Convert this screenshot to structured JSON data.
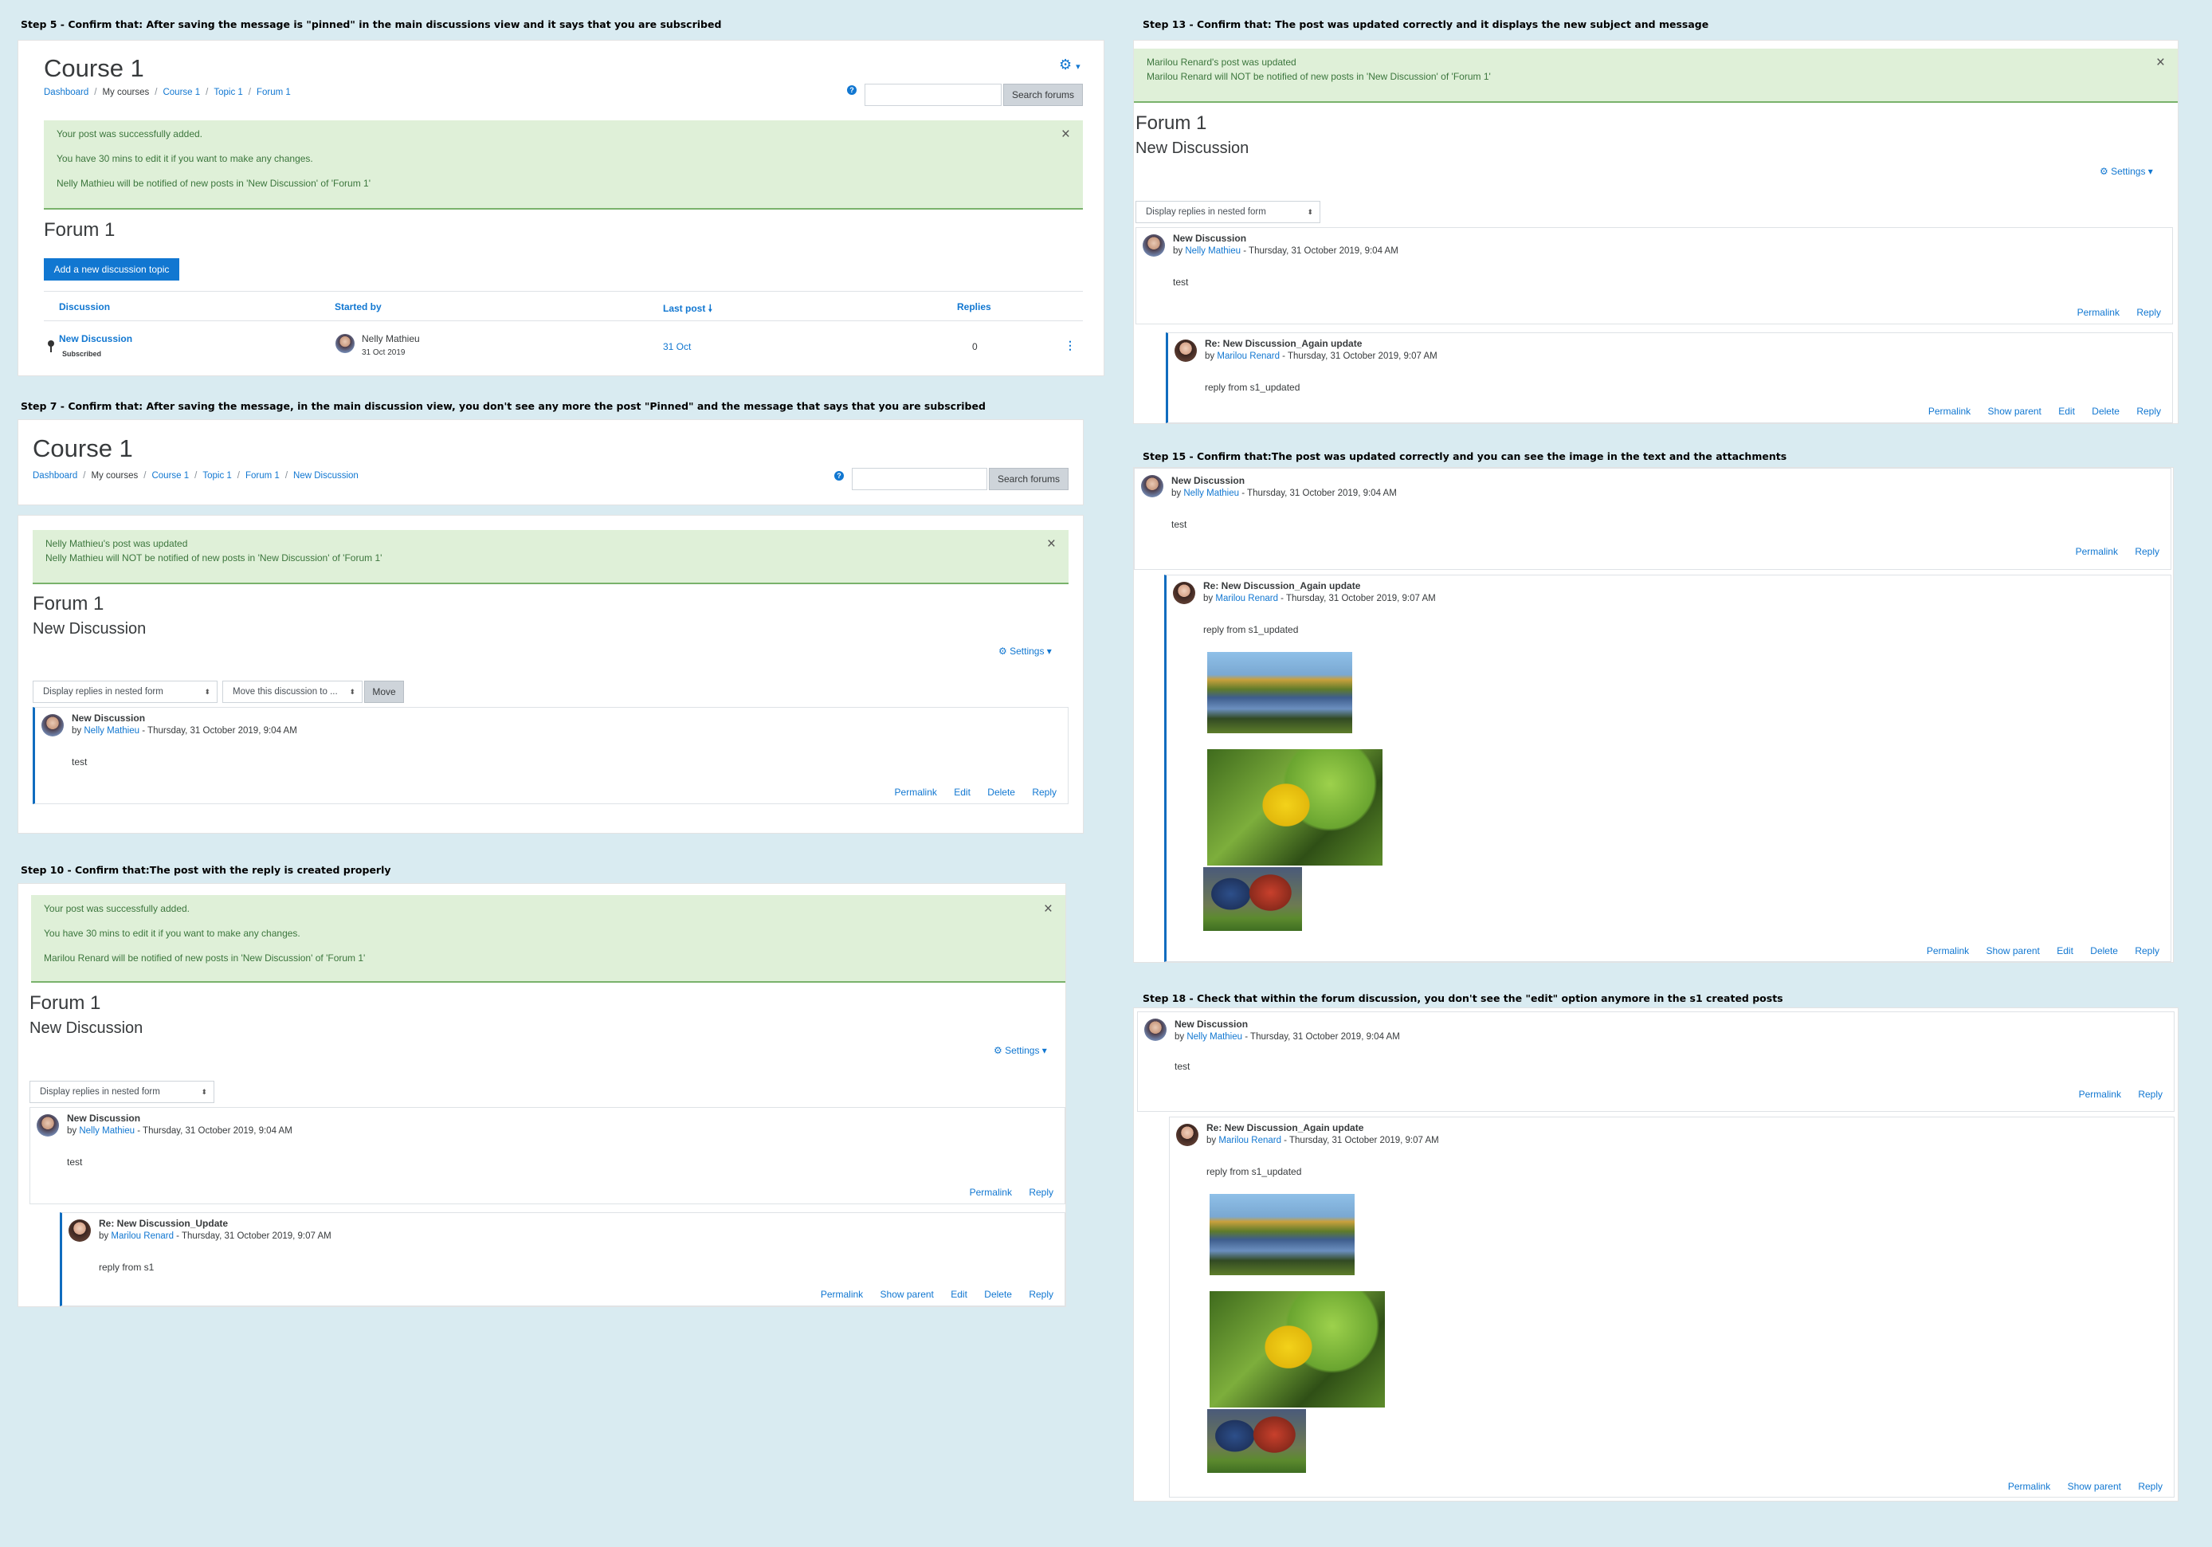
{
  "steps": {
    "s5": "Step 5 - Confirm that: After saving the message is \"pinned\" in the main discussions view and it says that you are subscribed",
    "s7": "Step 7 - Confirm that: After saving the message, in the main discussion view, you don't see any more the post \"Pinned\" and the message that says that you are subscribed",
    "s10": "Step 10 - Confirm that:The post with the reply is created properly",
    "s13": "Step 13 - Confirm that: The post was updated correctly and it displays the new subject and message",
    "s15": "Step 15 - Confirm that:The post was updated correctly and you can see the image in the text and the attachments",
    "s18": "Step 18 - Check that within the forum discussion, you don't see the \"edit\" option anymore in the s1 created posts"
  },
  "common": {
    "course_title": "Course 1",
    "crumb_dashboard": "Dashboard",
    "crumb_mycourses": "My courses",
    "crumb_course": "Course 1",
    "crumb_topic": "Topic 1",
    "crumb_forum": "Forum 1",
    "crumb_discussion": "New Discussion",
    "search_btn": "Search forums",
    "forum_title": "Forum 1",
    "discussion_title": "New Discussion",
    "settings": "Settings",
    "display_mode": "Display replies in nested form",
    "move_select": "Move this discussion to ...",
    "move_btn": "Move",
    "close": "×",
    "help": "?"
  },
  "s5": {
    "alert1": "Your post was successfully added.",
    "alert2": "You have 30 mins to edit it if you want to make any changes.",
    "alert3": "Nelly Mathieu will be notified of new posts in 'New Discussion' of 'Forum 1'",
    "add_btn": "Add a new discussion topic",
    "col_discussion": "Discussion",
    "col_started": "Started by",
    "col_last": "Last post",
    "col_replies": "Replies",
    "row_title": "New Discussion",
    "row_badge": "Subscribed",
    "row_author": "Nelly Mathieu",
    "row_date": "31 Oct 2019",
    "row_last": "31 Oct",
    "row_replies": "0",
    "kebab": "⋮"
  },
  "s7": {
    "alert1": "Nelly Mathieu's post was updated",
    "alert2": "Nelly Mathieu will NOT be notified of new posts in 'New Discussion' of 'Forum 1'"
  },
  "s10": {
    "alert1": "Your post was successfully added.",
    "alert2": "You have 30 mins to edit it if you want to make any changes.",
    "alert3": "Marilou Renard will be notified of new posts in 'New Discussion' of 'Forum 1'"
  },
  "s13": {
    "alert1": "Marilou Renard's post was updated",
    "alert2": "Marilou Renard will NOT be notified of new posts in 'New Discussion' of 'Forum 1'"
  },
  "posts": {
    "orig_title": "New Discussion",
    "by": "by",
    "orig_author": "Nelly Mathieu",
    "orig_date": " - Thursday, 31 October 2019, 9:04 AM",
    "orig_body": "test",
    "reply1_title": "Re: New Discussion_Update",
    "reply2_title": "Re: New Discussion_Again update",
    "reply_author": "Marilou Renard",
    "reply_date": " - Thursday, 31 October 2019, 9:07 AM",
    "reply1_body": "reply from s1",
    "reply2_body": "reply from s1_updated",
    "permalink": "Permalink",
    "show_parent": "Show parent",
    "edit": "Edit",
    "delete": "Delete",
    "reply": "Reply"
  },
  "colors": {
    "link": "#1177d1",
    "alert_bg": "#dff0d8",
    "alert_text": "#3c763d",
    "page_bg": "#d9ebf1"
  }
}
